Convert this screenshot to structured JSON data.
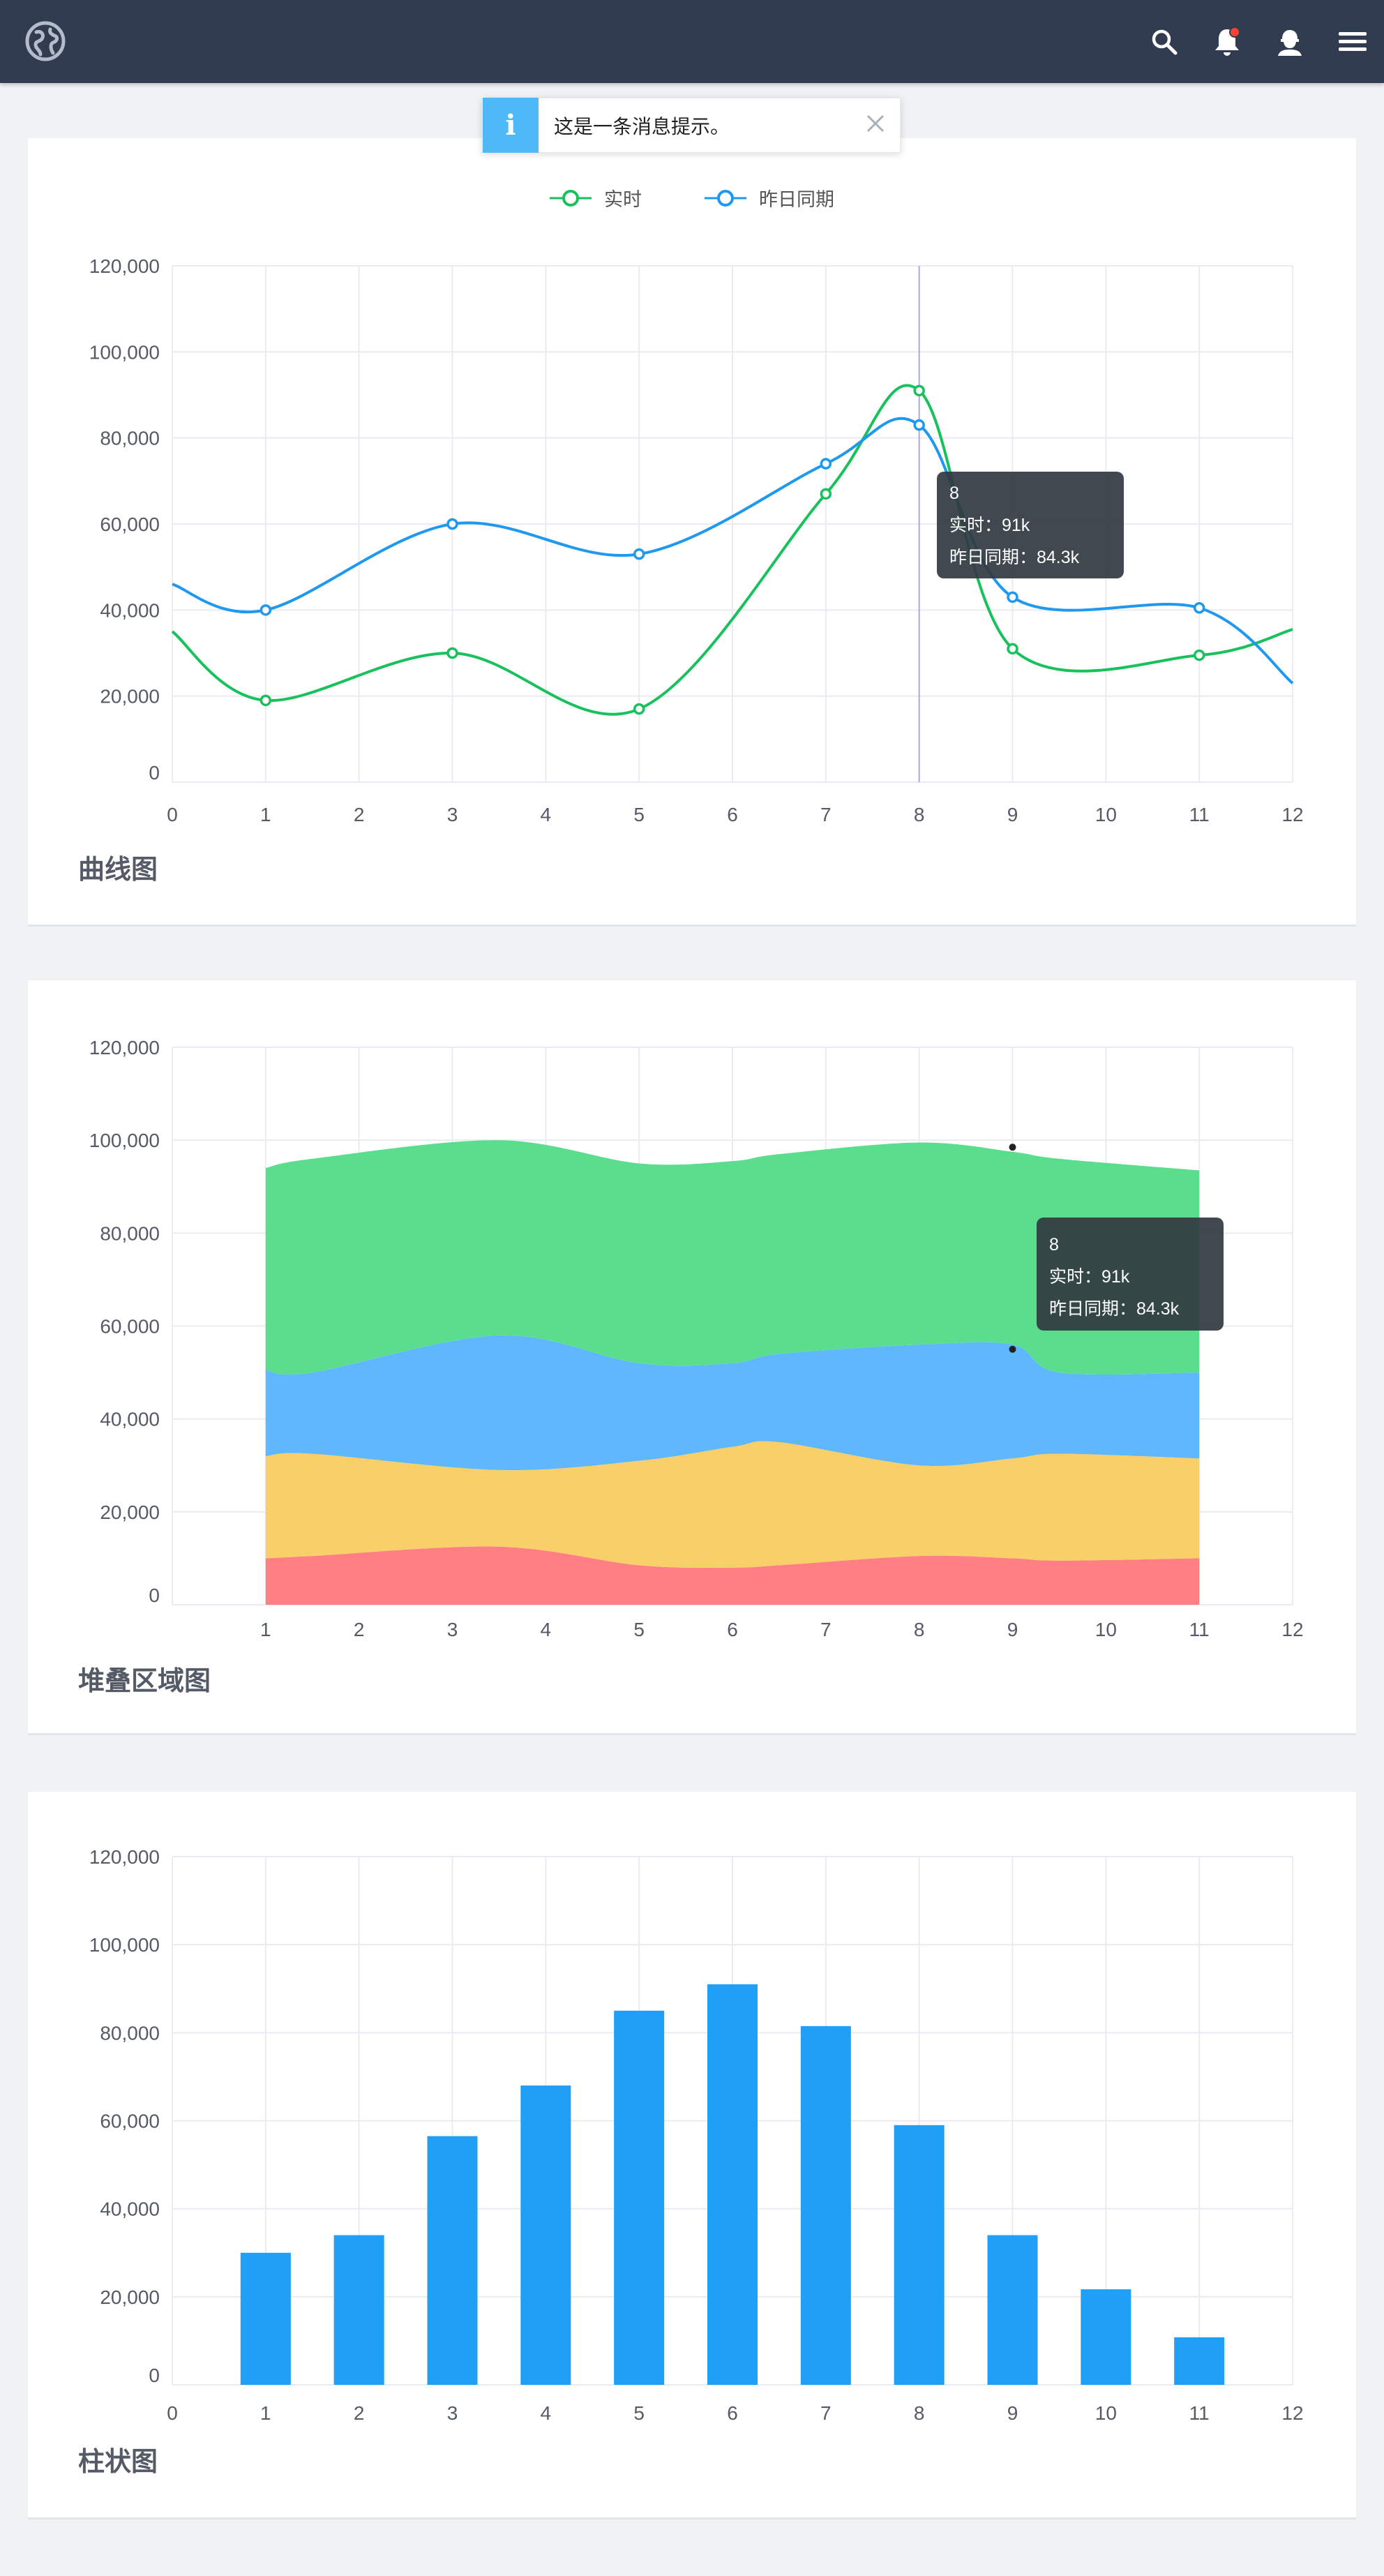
{
  "nav": {
    "icons": [
      "globe-icon",
      "search-icon",
      "bell-icon",
      "user-icon",
      "menu-icon"
    ],
    "notification_dot_color": "#f44336"
  },
  "toast": {
    "icon": "i",
    "message": "这是一条消息提示。"
  },
  "colors": {
    "green": "#19c15d",
    "blue": "#1f98f0",
    "red": "#ff7f82",
    "orange": "#f9cf6a",
    "light_blue": "#60b8fc",
    "light_green": "#5ade8e",
    "bar": "#1f9ff6"
  },
  "line_card": {
    "title": "曲线图",
    "legend": [
      "实时",
      "昨日同期"
    ],
    "tooltip": {
      "title": "8",
      "line1": "实时：91k",
      "line2": "昨日同期：84.3k"
    }
  },
  "area_card": {
    "title": "堆叠区域图",
    "tooltip": {
      "title": "8",
      "line1": "实时：91k",
      "line2": "昨日同期：84.3k"
    }
  },
  "bar_card": {
    "title": "柱状图"
  },
  "chart_data": [
    {
      "type": "line",
      "title": "曲线图",
      "x": [
        0,
        1,
        3,
        5,
        7,
        8,
        9,
        11,
        12
      ],
      "xticks": [
        0,
        1,
        2,
        3,
        4,
        5,
        6,
        7,
        8,
        9,
        10,
        11,
        12
      ],
      "yticks": [
        "0",
        "20,000",
        "40,000",
        "60,000",
        "80,000",
        "100,000",
        "120,000"
      ],
      "ylim": [
        0,
        120000
      ],
      "xlim": [
        0,
        12
      ],
      "grid": true,
      "legend_position": "top-center",
      "series": [
        {
          "name": "实时",
          "values": [
            35000,
            19000,
            30000,
            17000,
            67000,
            91000,
            31000,
            29500,
            35500
          ]
        },
        {
          "name": "昨日同期",
          "values": [
            46000,
            40000,
            60000,
            53000,
            74000,
            83000,
            43000,
            40500,
            23000
          ]
        }
      ]
    },
    {
      "type": "area",
      "title": "堆叠区域图",
      "stacked": true,
      "x": [
        1,
        1.5,
        3.5,
        5,
        6,
        6.5,
        8,
        9,
        9.5,
        11
      ],
      "xticks": [
        1,
        2,
        3,
        4,
        5,
        6,
        7,
        8,
        9,
        10,
        11,
        12
      ],
      "yticks": [
        "0",
        "20,000",
        "40,000",
        "60,000",
        "80,000",
        "100,000",
        "120,000"
      ],
      "ylim": [
        0,
        120000
      ],
      "xlim": [
        0.05,
        12
      ],
      "grid": true,
      "series": [
        {
          "name": "",
          "values": [
            10000,
            10500,
            12500,
            8500,
            8000,
            8500,
            10500,
            10000,
            9500,
            10000
          ]
        },
        {
          "name": "",
          "values": [
            22000,
            22000,
            16500,
            22500,
            26000,
            26500,
            19500,
            21500,
            23000,
            21500
          ]
        },
        {
          "name": "",
          "values": [
            18500,
            17500,
            29000,
            21000,
            18000,
            19000,
            26000,
            24500,
            17500,
            18500
          ]
        },
        {
          "name": "",
          "values": [
            43500,
            46000,
            42000,
            43000,
            43500,
            43000,
            43500,
            41500,
            46000,
            43500
          ]
        }
      ]
    },
    {
      "type": "bar",
      "title": "柱状图",
      "categories": [
        "1",
        "2",
        "3",
        "4",
        "5",
        "6",
        "7",
        "8",
        "9",
        "10",
        "11"
      ],
      "xticks": [
        0,
        1,
        2,
        3,
        4,
        5,
        6,
        7,
        8,
        9,
        10,
        11,
        12
      ],
      "values": [
        30000,
        34000,
        56500,
        68000,
        85000,
        91000,
        81500,
        59000,
        34000,
        21700,
        10800
      ],
      "yticks": [
        "0",
        "20,000",
        "40,000",
        "60,000",
        "80,000",
        "100,000",
        "120,000"
      ],
      "ylim": [
        0,
        120000
      ],
      "grid": true
    }
  ]
}
